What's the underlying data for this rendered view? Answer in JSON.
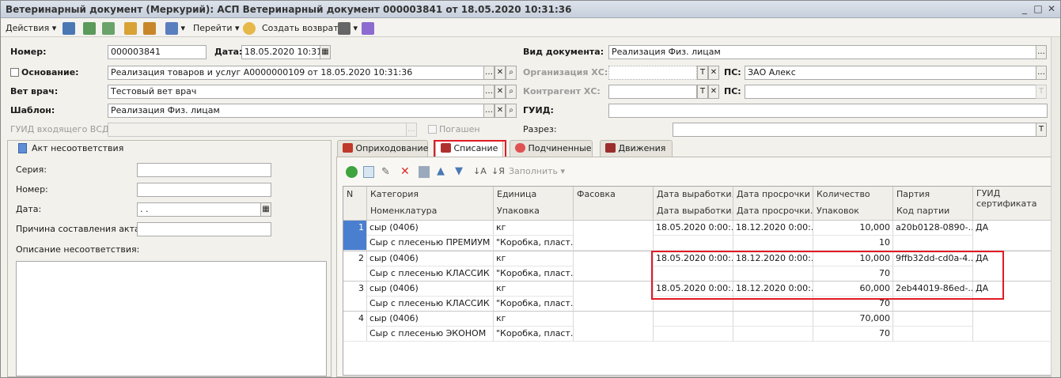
{
  "window": {
    "title": "Ветеринарный документ (Меркурий): АСП Ветеринарный документ 000003841 от 18.05.2020 10:31:36"
  },
  "toolbar": {
    "actions_label": "Действия",
    "goto_label": "Перейти",
    "create_return_label": "Создать возврат"
  },
  "form": {
    "number_label": "Номер:",
    "number_value": "000003841",
    "date_label": "Дата:",
    "date_value": "18.05.2020 10:31:3",
    "basis_label": "Основание:",
    "basis_value": "Реализация товаров и услуг А0000000109 от 18.05.2020 10:31:36",
    "vet_label": "Вет врач:",
    "vet_value": "Тестовый вет врач",
    "template_label": "Шаблон:",
    "template_value": "Реализация Физ. лицам",
    "guid_in_label": "ГУИД входящего ВСД:",
    "guid_in_value": "",
    "repaid_label": "Погашен",
    "doctype_label": "Вид документа:",
    "doctype_value": "Реализация Физ. лицам",
    "org_label": "Организация ХС:",
    "org_value": "",
    "ps_label": "ПС:",
    "ps_value": "ЗАО  Алекс",
    "contractor_label": "Контрагент ХС:",
    "contractor_value": "",
    "ps2_label": "ПС:",
    "ps2_value": "",
    "guid_label": "ГУИД:",
    "guid_value": "",
    "section_label": "Разрез:",
    "section_value": "",
    "t_letter": "T"
  },
  "act": {
    "title": "Акт несоответствия",
    "series_label": "Серия:",
    "number_label": "Номер:",
    "date_label": "Дата:",
    "date_value": " .  .",
    "reason_label": "Причина составления акта:",
    "description_label": "Описание несоответствия:"
  },
  "tabs": [
    {
      "label": "Оприходование"
    },
    {
      "label": "Списание"
    },
    {
      "label": "Подчиненные"
    },
    {
      "label": "Движения"
    }
  ],
  "grid_toolbar": {
    "fill_label": "Заполнить"
  },
  "grid": {
    "headers_top": [
      "N",
      "Категория",
      "Единица",
      "Фасовка",
      "Дата выработки...",
      "Дата просрочки",
      "Количество",
      "Партия",
      "ГУИД сертификата"
    ],
    "headers_bottom": [
      "Номенклатура",
      "Упаковка",
      "Дата выработки...",
      "Дата просрочки...",
      "Упаковок",
      "Код партии"
    ],
    "rows": [
      {
        "n": "1",
        "category": "сыр (0406)",
        "unit": "кг",
        "pack": "",
        "made": "18.05.2020 0:00:...",
        "expiry": "18.12.2020 0:00:...",
        "qty": "10,000",
        "batch": "a20b0128-0890-...",
        "guid": "ДА",
        "nomenclature": "Сыр с плесенью ПРЕМИУМ",
        "packaging": "\"Коробка, пласт...",
        "made2": "",
        "expiry2": "",
        "packs": "10",
        "batch_code": ""
      },
      {
        "n": "2",
        "category": "сыр (0406)",
        "unit": "кг",
        "pack": "",
        "made": "18.05.2020 0:00:...",
        "expiry": "18.12.2020 0:00:...",
        "qty": "10,000",
        "batch": "9ffb32dd-cd0a-4...",
        "guid": "ДА",
        "nomenclature": "Сыр с плесенью КЛАССИК",
        "packaging": "\"Коробка, пласт...",
        "made2": "",
        "expiry2": "",
        "packs": "70",
        "batch_code": ""
      },
      {
        "n": "3",
        "category": "сыр (0406)",
        "unit": "кг",
        "pack": "",
        "made": "18.05.2020 0:00:...",
        "expiry": "18.12.2020 0:00:...",
        "qty": "60,000",
        "batch": "2eb44019-86ed-...",
        "guid": "ДА",
        "nomenclature": "Сыр с плесенью КЛАССИК",
        "packaging": "\"Коробка, пласт...",
        "made2": "",
        "expiry2": "",
        "packs": "70",
        "batch_code": ""
      },
      {
        "n": "4",
        "category": "сыр (0406)",
        "unit": "кг",
        "pack": "",
        "made": "",
        "expiry": "",
        "qty": "70,000",
        "batch": "",
        "guid": "",
        "nomenclature": "Сыр с плесенью ЭКОНОМ",
        "packaging": "\"Коробка, пласт...",
        "made2": "",
        "expiry2": "",
        "packs": "70",
        "batch_code": ""
      }
    ]
  },
  "colors": {
    "highlight": "#e01b24",
    "selection": "#4a7fd0"
  }
}
